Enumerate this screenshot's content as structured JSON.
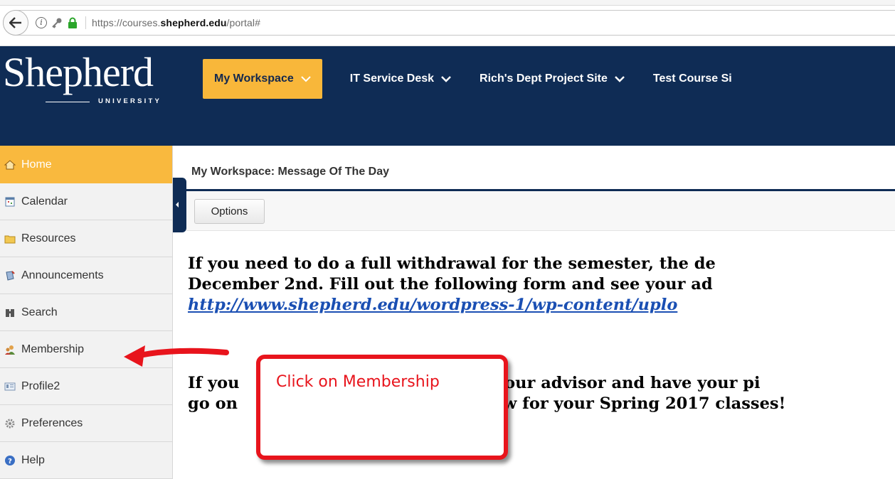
{
  "browser": {
    "url_prefix": "https://courses.",
    "url_domain": "shepherd.edu",
    "url_path": "/portal#"
  },
  "header": {
    "logo_word": "Shepherd",
    "logo_sub": "UNIVERSITY",
    "tabs": [
      {
        "label": "My Workspace",
        "active": true
      },
      {
        "label": "IT Service Desk",
        "active": false
      },
      {
        "label": "Rich's Dept Project Site",
        "active": false
      },
      {
        "label": "Test Course Si",
        "active": false
      }
    ]
  },
  "sidebar": {
    "items": [
      {
        "label": "Home",
        "icon": "home-icon",
        "active": true
      },
      {
        "label": "Calendar",
        "icon": "calendar-icon"
      },
      {
        "label": "Resources",
        "icon": "folder-icon"
      },
      {
        "label": "Announcements",
        "icon": "announcement-icon"
      },
      {
        "label": "Search",
        "icon": "search-icon"
      },
      {
        "label": "Membership",
        "icon": "membership-icon"
      },
      {
        "label": "Profile2",
        "icon": "profile-icon"
      },
      {
        "label": "Preferences",
        "icon": "gear-icon"
      },
      {
        "label": "Help",
        "icon": "help-icon"
      }
    ]
  },
  "main": {
    "title": "My Workspace: Message Of The Day",
    "options_label": "Options",
    "message_line1": "If you need to do a full withdrawal for the semester, the de",
    "message_line2": "December 2nd.  Fill out the following form and see your ad",
    "message_link": "http://www.shepherd.edu/wordpress-1/wp-content/uplo",
    "message2_line1a": "If you",
    "message2_line1b": "th your advisor and have your pi",
    "message2_line2a": "go on",
    "message2_line2b": "w for your Spring 2017 classes!"
  },
  "annotation": {
    "callout_text": "Click on Membership",
    "color": "#e8141c"
  },
  "colors": {
    "header_bg": "#0f2c55",
    "active_tab": "#f8b73a",
    "link": "#1a4fb3"
  }
}
